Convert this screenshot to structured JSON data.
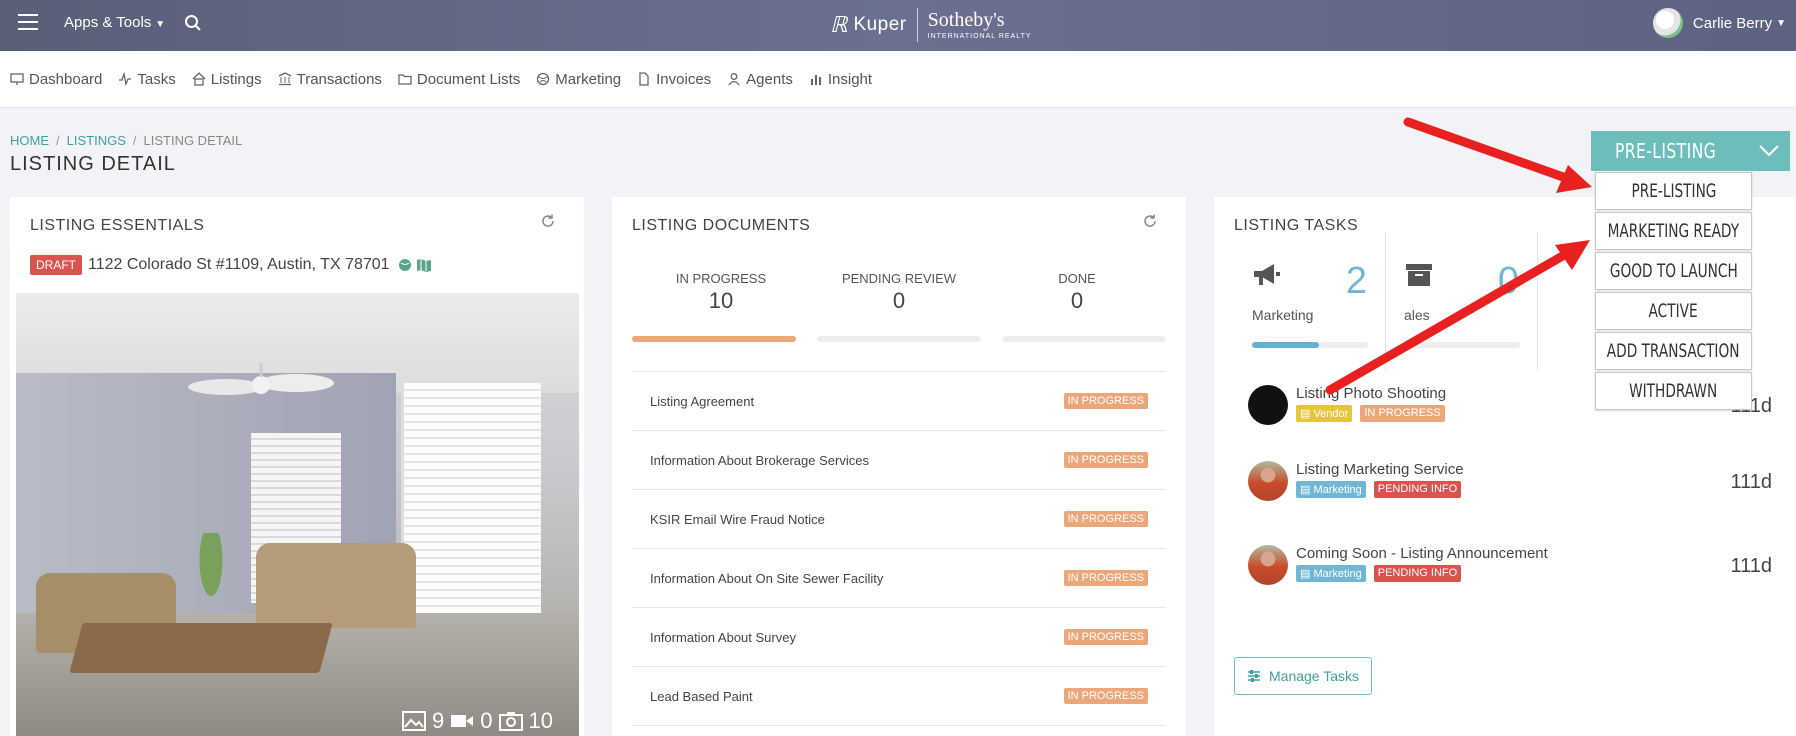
{
  "header": {
    "apps_label": "Apps & Tools",
    "brand_left": "Kuper",
    "brand_right": "Sotheby's",
    "brand_sub": "INTERNATIONAL REALTY",
    "user_name": "Carlie Berry"
  },
  "nav": {
    "items": [
      {
        "label": "Dashboard",
        "icon": "monitor-icon"
      },
      {
        "label": "Tasks",
        "icon": "activity-icon"
      },
      {
        "label": "Listings",
        "icon": "home-icon"
      },
      {
        "label": "Transactions",
        "icon": "bank-icon"
      },
      {
        "label": "Document Lists",
        "icon": "folder-icon"
      },
      {
        "label": "Marketing",
        "icon": "globe-icon"
      },
      {
        "label": "Invoices",
        "icon": "file-icon"
      },
      {
        "label": "Agents",
        "icon": "user-icon"
      },
      {
        "label": "Insight",
        "icon": "bar-chart-icon"
      }
    ]
  },
  "breadcrumb": {
    "home": "HOME",
    "listings": "LISTINGS",
    "current": "LISTING DETAIL"
  },
  "page_title": "LISTING DETAIL",
  "essentials": {
    "title": "LISTING ESSENTIALS",
    "status_badge": "DRAFT",
    "address": "1122 Colorado St #1109, Austin, TX 78701",
    "photos_count": "9",
    "videos_count": "0",
    "tours_count": "10"
  },
  "documents": {
    "title": "LISTING DOCUMENTS",
    "stats": [
      {
        "label": "IN PROGRESS",
        "value": "10",
        "progress": 1.0,
        "color": "#eba77a"
      },
      {
        "label": "PENDING REVIEW",
        "value": "0",
        "progress": 0,
        "color": "#eeeeee"
      },
      {
        "label": "DONE",
        "value": "0",
        "progress": 0,
        "color": "#eeeeee"
      }
    ],
    "rows": [
      {
        "name": "Listing Agreement",
        "status": "IN PROGRESS"
      },
      {
        "name": "Information About Brokerage Services",
        "status": "IN PROGRESS"
      },
      {
        "name": "KSIR Email Wire Fraud Notice",
        "status": "IN PROGRESS"
      },
      {
        "name": "Information About On Site Sewer Facility",
        "status": "IN PROGRESS"
      },
      {
        "name": "Information About Survey",
        "status": "IN PROGRESS"
      },
      {
        "name": "Lead Based Paint",
        "status": "IN PROGRESS"
      }
    ]
  },
  "tasks": {
    "title": "LISTING TASKS",
    "stats": [
      {
        "label": "Marketing",
        "value": "2",
        "progress": 0.58,
        "icon": "megaphone-icon"
      },
      {
        "label": "ales",
        "value": "0",
        "progress": 0,
        "icon": "archive-icon"
      }
    ],
    "rows": [
      {
        "name": "Listing Photo Shooting",
        "tag1": "Vendor",
        "tag2": "IN PROGRESS",
        "days": "111d",
        "avatar": "black"
      },
      {
        "name": "Listing Marketing Service",
        "tag1": "Marketing",
        "tag2": "PENDING INFO",
        "days": "111d",
        "avatar": "person"
      },
      {
        "name": "Coming Soon - Listing Announcement",
        "tag1": "Marketing",
        "tag2": "PENDING INFO",
        "days": "111d",
        "avatar": "person"
      }
    ],
    "manage_label": "Manage Tasks"
  },
  "status_dropdown": {
    "current": "PRE-LISTING",
    "options": [
      "PRE-LISTING",
      "MARKETING READY",
      "GOOD TO LAUNCH",
      "ACTIVE",
      "ADD TRANSACTION",
      "WITHDRAWN"
    ]
  },
  "colors": {
    "accent": "#6dbdbb",
    "link": "#3fa0a0",
    "header": "#5f6482",
    "annotation_arrow": "#e8201f"
  }
}
